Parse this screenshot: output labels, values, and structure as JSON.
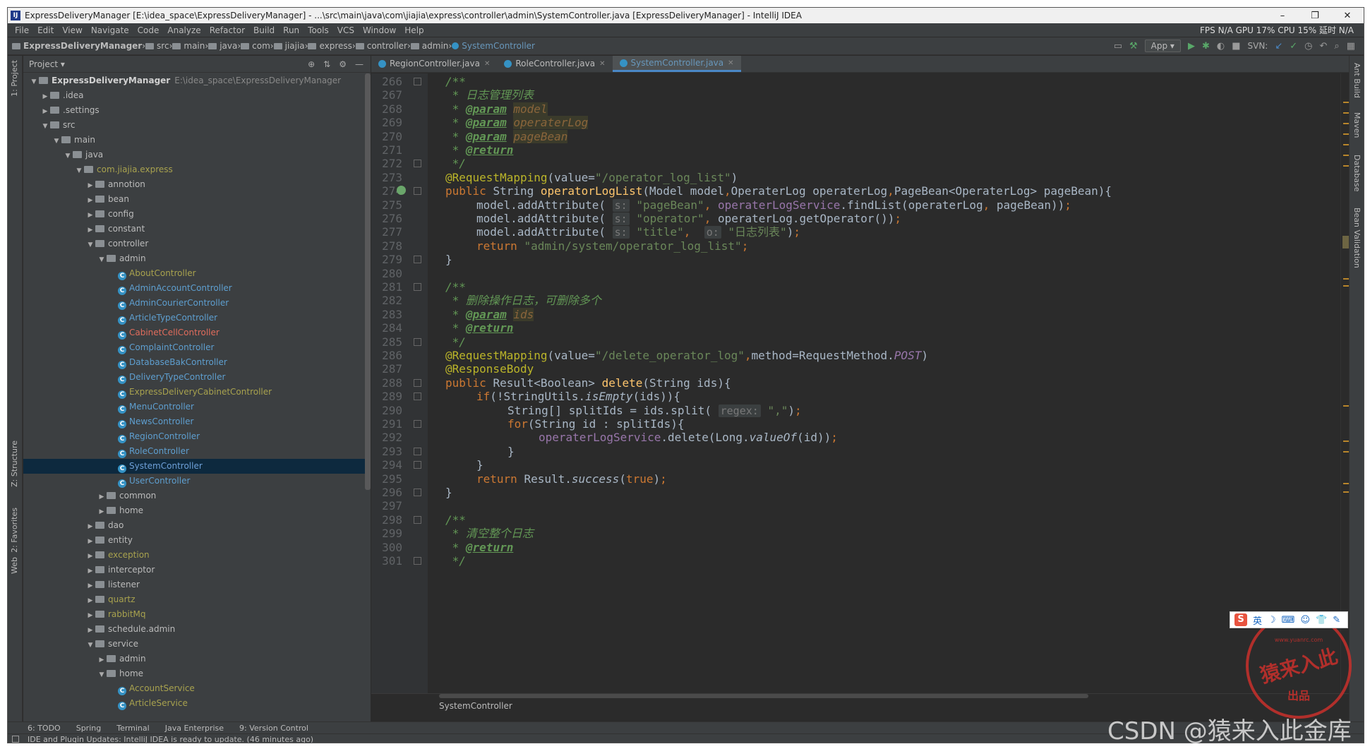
{
  "window": {
    "title": "ExpressDeliveryManager [E:\\idea_space\\ExpressDeliveryManager] - ...\\src\\main\\java\\com\\jiajia\\express\\controller\\admin\\SystemController.java [ExpressDeliveryManager] - IntelliJ IDEA",
    "minimize": "–",
    "maximize": "❐",
    "close": "✕"
  },
  "menu": [
    "File",
    "Edit",
    "View",
    "Navigate",
    "Code",
    "Analyze",
    "Refactor",
    "Build",
    "Run",
    "Tools",
    "VCS",
    "Window",
    "Help"
  ],
  "perf": "FPS N/A GPU 17% CPU 15% 延时 N/A",
  "breadcrumb": [
    "ExpressDeliveryManager",
    "src",
    "main",
    "java",
    "com",
    "jiajia",
    "express",
    "controller",
    "admin",
    "SystemController"
  ],
  "run_config": "App ▾",
  "svn_label": "SVN:",
  "project_panel": {
    "title": "Project ▾",
    "tree": [
      {
        "label": "ExpressDeliveryManager",
        "path": "E:\\idea_space\\ExpressDeliveryManager",
        "level": 0,
        "arrow": "▼",
        "kind": "folder",
        "style": "bold"
      },
      {
        "label": ".idea",
        "level": 1,
        "arrow": "▶",
        "kind": "folder"
      },
      {
        "label": ".settings",
        "level": 1,
        "arrow": "▶",
        "kind": "folder"
      },
      {
        "label": "src",
        "level": 1,
        "arrow": "▼",
        "kind": "folder"
      },
      {
        "label": "main",
        "level": 2,
        "arrow": "▼",
        "kind": "folder"
      },
      {
        "label": "java",
        "level": 3,
        "arrow": "▼",
        "kind": "folder"
      },
      {
        "label": "com.jiajia.express",
        "level": 4,
        "arrow": "▼",
        "kind": "folder",
        "style": "olive"
      },
      {
        "label": "annotion",
        "level": 5,
        "arrow": "▶",
        "kind": "folder"
      },
      {
        "label": "bean",
        "level": 5,
        "arrow": "▶",
        "kind": "folder"
      },
      {
        "label": "config",
        "level": 5,
        "arrow": "▶",
        "kind": "folder"
      },
      {
        "label": "constant",
        "level": 5,
        "arrow": "▶",
        "kind": "folder"
      },
      {
        "label": "controller",
        "level": 5,
        "arrow": "▼",
        "kind": "folder"
      },
      {
        "label": "admin",
        "level": 6,
        "arrow": "▼",
        "kind": "folder"
      },
      {
        "label": "AboutController",
        "level": 7,
        "arrow": "",
        "kind": "class",
        "style": "olive"
      },
      {
        "label": "AdminAccountController",
        "level": 7,
        "arrow": "",
        "kind": "class",
        "style": "blue"
      },
      {
        "label": "AdminCourierController",
        "level": 7,
        "arrow": "",
        "kind": "class",
        "style": "blue"
      },
      {
        "label": "ArticleTypeController",
        "level": 7,
        "arrow": "",
        "kind": "class",
        "style": "blue"
      },
      {
        "label": "CabinetCellController",
        "level": 7,
        "arrow": "",
        "kind": "class",
        "style": "red"
      },
      {
        "label": "ComplaintController",
        "level": 7,
        "arrow": "",
        "kind": "class",
        "style": "blue"
      },
      {
        "label": "DatabaseBakController",
        "level": 7,
        "arrow": "",
        "kind": "class",
        "style": "blue"
      },
      {
        "label": "DeliveryTypeController",
        "level": 7,
        "arrow": "",
        "kind": "class",
        "style": "blue"
      },
      {
        "label": "ExpressDeliveryCabinetController",
        "level": 7,
        "arrow": "",
        "kind": "class",
        "style": "olive"
      },
      {
        "label": "MenuController",
        "level": 7,
        "arrow": "",
        "kind": "class",
        "style": "blue"
      },
      {
        "label": "NewsController",
        "level": 7,
        "arrow": "",
        "kind": "class",
        "style": "blue"
      },
      {
        "label": "RegionController",
        "level": 7,
        "arrow": "",
        "kind": "class",
        "style": "blue"
      },
      {
        "label": "RoleController",
        "level": 7,
        "arrow": "",
        "kind": "class",
        "style": "blue"
      },
      {
        "label": "SystemController",
        "level": 7,
        "arrow": "",
        "kind": "class",
        "style": "blue",
        "selected": true
      },
      {
        "label": "UserController",
        "level": 7,
        "arrow": "",
        "kind": "class",
        "style": "blue"
      },
      {
        "label": "common",
        "level": 6,
        "arrow": "▶",
        "kind": "folder"
      },
      {
        "label": "home",
        "level": 6,
        "arrow": "▶",
        "kind": "folder"
      },
      {
        "label": "dao",
        "level": 5,
        "arrow": "▶",
        "kind": "folder"
      },
      {
        "label": "entity",
        "level": 5,
        "arrow": "▶",
        "kind": "folder"
      },
      {
        "label": "exception",
        "level": 5,
        "arrow": "▶",
        "kind": "folder",
        "style": "olive"
      },
      {
        "label": "interceptor",
        "level": 5,
        "arrow": "▶",
        "kind": "folder"
      },
      {
        "label": "listener",
        "level": 5,
        "arrow": "▶",
        "kind": "folder"
      },
      {
        "label": "quartz",
        "level": 5,
        "arrow": "▶",
        "kind": "folder",
        "style": "olive"
      },
      {
        "label": "rabbitMq",
        "level": 5,
        "arrow": "▶",
        "kind": "folder",
        "style": "olive"
      },
      {
        "label": "schedule.admin",
        "level": 5,
        "arrow": "▶",
        "kind": "folder"
      },
      {
        "label": "service",
        "level": 5,
        "arrow": "▼",
        "kind": "folder"
      },
      {
        "label": "admin",
        "level": 6,
        "arrow": "▶",
        "kind": "folder"
      },
      {
        "label": "home",
        "level": 6,
        "arrow": "▼",
        "kind": "folder"
      },
      {
        "label": "AccountService",
        "level": 7,
        "arrow": "",
        "kind": "class",
        "style": "olive"
      },
      {
        "label": "ArticleService",
        "level": 7,
        "arrow": "",
        "kind": "class",
        "style": "olive"
      }
    ]
  },
  "editor_tabs": [
    {
      "label": "RegionController.java",
      "active": false
    },
    {
      "label": "RoleController.java",
      "active": false
    },
    {
      "label": "SystemController.java",
      "active": true
    }
  ],
  "code_lines": [
    {
      "n": "266",
      "fold": true,
      "html": "<span class=\"cm\">/**</span>",
      "indent": 0
    },
    {
      "n": "267",
      "html": "<span class=\"cm\"> * 日志管理列表</span>",
      "indent": 0
    },
    {
      "n": "268",
      "html": "<span class=\"cm\"> * </span><span class=\"tag\">@param</span> <span class=\"pname\">model</span>",
      "indent": 0
    },
    {
      "n": "269",
      "html": "<span class=\"cm\"> * </span><span class=\"tag\">@param</span> <span class=\"pname\">operaterLog</span>",
      "indent": 0
    },
    {
      "n": "270",
      "html": "<span class=\"cm\"> * </span><span class=\"tag\">@param</span> <span class=\"pname\">pageBean</span>",
      "indent": 0
    },
    {
      "n": "271",
      "html": "<span class=\"cm\"> * </span><span class=\"tag\">@return</span>",
      "indent": 0
    },
    {
      "n": "272",
      "fold": true,
      "html": "<span class=\"cm\"> */</span>",
      "indent": 0
    },
    {
      "n": "273",
      "html": "<span class=\"ann\">@RequestMapping</span><span class=\"plain\">(value=</span><span class=\"str\">\"/operator_log_list\"</span><span class=\"plain\">)</span>",
      "indent": 0
    },
    {
      "n": "274",
      "fold": true,
      "icon": true,
      "html": "<span class=\"kw\">public </span><span class=\"plain\">String </span><span class=\"fn\">operatorLogList</span><span class=\"plain\">(Model model</span><span class=\"kw\">,</span><span class=\"plain\">OperaterLog operaterLog</span><span class=\"kw\">,</span><span class=\"plain\">PageBean&lt;OperaterLog&gt; pageBean){</span>",
      "indent": 0
    },
    {
      "n": "275",
      "html": "<span class=\"plain\">model.addAttribute( </span><span class=\"hint\">s:</span> <span class=\"str\">\"pageBean\"</span><span class=\"kw\">, </span><span class=\"fld\">operaterLogService</span><span class=\"plain\">.findList(operaterLog</span><span class=\"kw\">, </span><span class=\"plain\">pageBean))</span><span class=\"kw\">;</span>",
      "indent": 1
    },
    {
      "n": "276",
      "html": "<span class=\"plain\">model.addAttribute( </span><span class=\"hint\">s:</span> <span class=\"str\">\"operator\"</span><span class=\"kw\">, </span><span class=\"plain\">operaterLog.getOperator())</span><span class=\"kw\">;</span>",
      "indent": 1
    },
    {
      "n": "277",
      "html": "<span class=\"plain\">model.addAttribute( </span><span class=\"hint\">s:</span> <span class=\"str\">\"title\"</span><span class=\"kw\">, </span> <span class=\"hint\">o:</span> <span class=\"str\">\"日志列表\"</span><span class=\"plain\">)</span><span class=\"kw\">;</span>",
      "indent": 1
    },
    {
      "n": "278",
      "html": "<span class=\"kw\">return </span><span class=\"str\">\"admin/system/operator_log_list\"</span><span class=\"kw\">;</span>",
      "indent": 1
    },
    {
      "n": "279",
      "fold": true,
      "html": "<span class=\"plain\">}</span>",
      "indent": 0
    },
    {
      "n": "280",
      "html": "",
      "indent": 0
    },
    {
      "n": "281",
      "fold": true,
      "html": "<span class=\"cm\">/**</span>",
      "indent": 0
    },
    {
      "n": "282",
      "html": "<span class=\"cm\"> * 删除操作日志，可删除多个</span>",
      "indent": 0
    },
    {
      "n": "283",
      "html": "<span class=\"cm\"> * </span><span class=\"tag\">@param</span> <span class=\"pname\">ids</span>",
      "indent": 0
    },
    {
      "n": "284",
      "html": "<span class=\"cm\"> * </span><span class=\"tag\">@return</span>",
      "indent": 0
    },
    {
      "n": "285",
      "fold": true,
      "html": "<span class=\"cm\"> */</span>",
      "indent": 0
    },
    {
      "n": "286",
      "html": "<span class=\"ann\">@RequestMapping</span><span class=\"plain\">(value=</span><span class=\"str\">\"/delete_operator_log\"</span><span class=\"kw\">,</span><span class=\"plain\">method=RequestMethod.</span><span class=\"fld it\">POST</span><span class=\"plain\">)</span>",
      "indent": 0
    },
    {
      "n": "287",
      "html": "<span class=\"ann\">@ResponseBody</span>",
      "indent": 0
    },
    {
      "n": "288",
      "fold": true,
      "html": "<span class=\"kw\">public </span><span class=\"plain\">Result&lt;Boolean&gt; </span><span class=\"fn\">delete</span><span class=\"plain\">(String ids){</span>",
      "indent": 0
    },
    {
      "n": "289",
      "fold": true,
      "html": "<span class=\"kw\">if</span><span class=\"plain\">(!StringUtils.</span><span class=\"plain it\">isEmpty</span><span class=\"plain\">(ids)){</span>",
      "indent": 1
    },
    {
      "n": "290",
      "html": "<span class=\"plain\">String[] splitIds = ids.split( </span><span class=\"hint\">regex:</span> <span class=\"str\">\",\"</span><span class=\"plain\">)</span><span class=\"kw\">;</span>",
      "indent": 2
    },
    {
      "n": "291",
      "fold": true,
      "html": "<span class=\"kw\">for</span><span class=\"plain\">(String id : splitIds){</span>",
      "indent": 2
    },
    {
      "n": "292",
      "html": "<span class=\"fld\">operaterLogService</span><span class=\"plain\">.delete(Long.</span><span class=\"plain it\">valueOf</span><span class=\"plain\">(id))</span><span class=\"kw\">;</span>",
      "indent": 3
    },
    {
      "n": "293",
      "fold": true,
      "html": "<span class=\"plain\">}</span>",
      "indent": 2
    },
    {
      "n": "294",
      "fold": true,
      "html": "<span class=\"plain\">}</span>",
      "indent": 1
    },
    {
      "n": "295",
      "html": "<span class=\"kw\">return </span><span class=\"plain\">Result.</span><span class=\"plain it\">success</span><span class=\"plain\">(</span><span class=\"kw\">true</span><span class=\"plain\">)</span><span class=\"kw\">;</span>",
      "indent": 1
    },
    {
      "n": "296",
      "fold": true,
      "html": "<span class=\"plain\">}</span>",
      "indent": 0
    },
    {
      "n": "297",
      "html": "",
      "indent": 0
    },
    {
      "n": "298",
      "fold": true,
      "html": "<span class=\"cm\">/**</span>",
      "indent": 0
    },
    {
      "n": "299",
      "html": "<span class=\"cm\"> * 清空整个日志</span>",
      "indent": 0
    },
    {
      "n": "300",
      "html": "<span class=\"cm\"> * </span><span class=\"tag\">@return</span>",
      "indent": 0
    },
    {
      "n": "301",
      "fold": true,
      "html": "<span class=\"cm\"> */</span>",
      "indent": 0
    }
  ],
  "editor_breadcrumb": "SystemController",
  "left_stripe": [
    "1: Project",
    "Z: Structure",
    "2: Favorites",
    "Web"
  ],
  "right_stripe": [
    "Ant Build",
    "Maven",
    "Database",
    "Bean Validation"
  ],
  "bottom_tools": [
    "6: TODO",
    "Spring",
    "Terminal",
    "Java Enterprise",
    "9: Version Control"
  ],
  "status": "IDE and Plugin Updates: IntelliJ IDEA is ready to update. (46 minutes ago)",
  "ime": {
    "logo": "S",
    "lang": "英"
  },
  "seal": {
    "url": "www.yuanrc.com",
    "big": "猿来入此",
    "small": "出品"
  },
  "watermark": "CSDN @猿来入此金库",
  "colors": {
    "background": "#2b2b2b",
    "panel": "#3c3f41",
    "selection": "#0d293e",
    "accent": "#4a88c7"
  }
}
